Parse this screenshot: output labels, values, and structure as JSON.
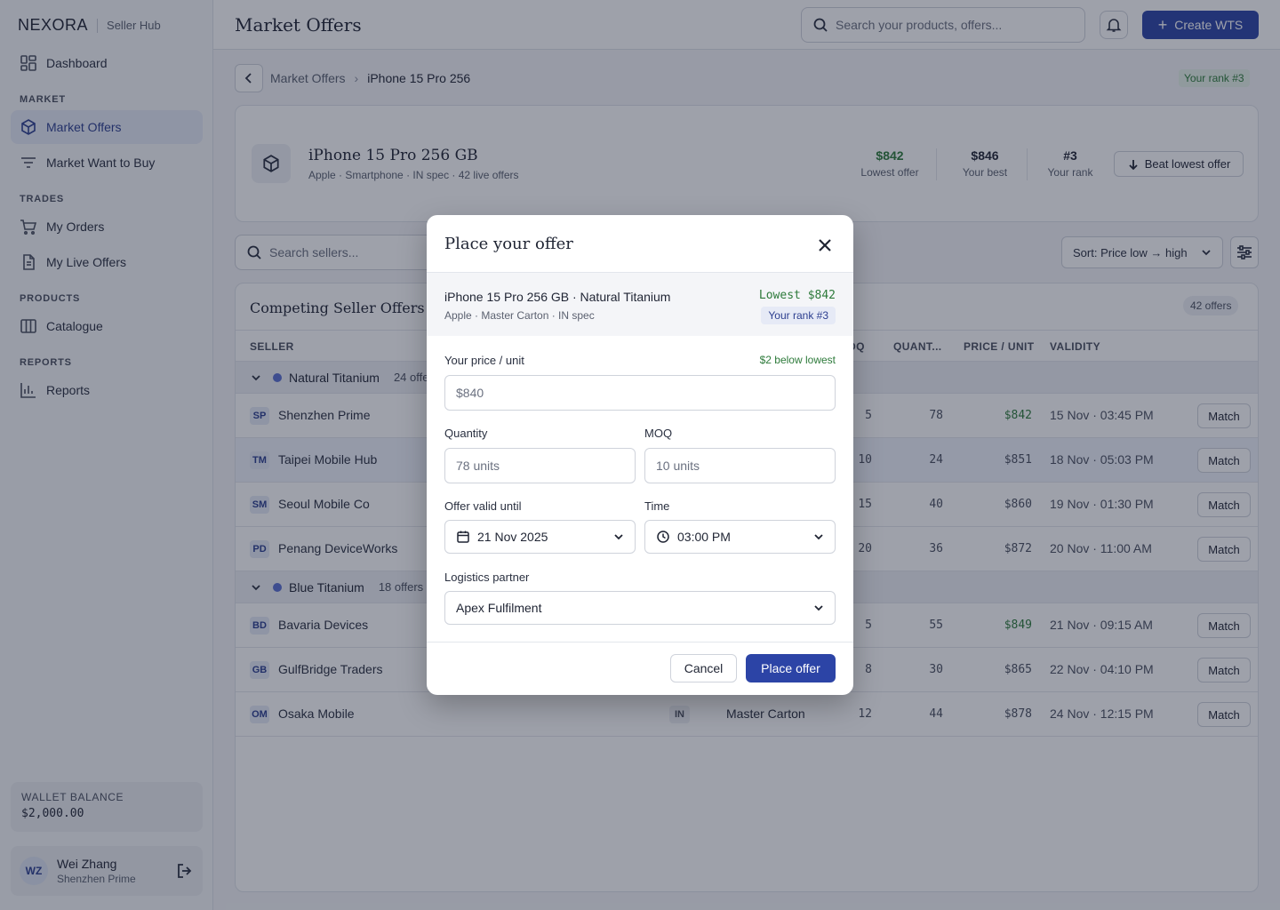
{
  "brand": {
    "name": "NEXORA",
    "sub": "Seller Hub"
  },
  "nav": {
    "dashboard": "Dashboard",
    "section_market": "MARKET",
    "market_offers": "Market Offers",
    "market_wtb": "Market Want to Buy",
    "section_trades": "TRADES",
    "my_orders": "My Orders",
    "my_live_offers": "My Live Offers",
    "section_products": "PRODUCTS",
    "catalogue": "Catalogue",
    "section_reports": "REPORTS",
    "reports": "Reports"
  },
  "wallet": {
    "label": "WALLET BALANCE",
    "value": "$2,000.00"
  },
  "user": {
    "initials": "WZ",
    "name": "Wei Zhang",
    "company": "Shenzhen Prime"
  },
  "topbar": {
    "title": "Market Offers",
    "search_placeholder": "Search your products, offers...",
    "create_label": "Create WTS"
  },
  "breadcrumb": {
    "parent": "Market Offers",
    "current": "iPhone 15 Pro 256",
    "rank_badge": "Your rank #3"
  },
  "product": {
    "title": "iPhone 15 Pro 256 GB",
    "sub": "Apple · Smartphone · IN spec · 42 live offers",
    "lowest_value": "$842",
    "lowest_label": "Lowest offer",
    "best_value": "$846",
    "best_label": "Your best",
    "rank_value": "#3",
    "rank_label": "Your rank",
    "beat_label": "Beat lowest offer"
  },
  "filters": {
    "seller_search_placeholder": "Search sellers...",
    "sort_label": "Sort: Price low → high"
  },
  "table": {
    "title": "Competing Seller Offers",
    "count": "42 offers",
    "headers": {
      "seller": "SELLER",
      "moq": "MOQ",
      "quantity": "QUANT...",
      "price": "PRICE / UNIT",
      "validity": "VALIDITY"
    },
    "groups": [
      {
        "name": "Natural Titanium",
        "count": "24 offers"
      },
      {
        "name": "Blue Titanium",
        "count": "18 offers"
      }
    ],
    "rows": [
      {
        "initials": "SP",
        "name": "Shenzhen Prime",
        "moq": "5",
        "qty": "78",
        "price": "$842",
        "validity": "15 Nov · 03:45 PM",
        "action": "Match"
      },
      {
        "initials": "TM",
        "name": "Taipei Mobile Hub",
        "moq": "10",
        "qty": "24",
        "price": "$851",
        "validity": "18 Nov · 05:03 PM",
        "action": "Match"
      },
      {
        "initials": "SM",
        "name": "Seoul Mobile Co",
        "moq": "15",
        "qty": "40",
        "price": "$860",
        "validity": "19 Nov · 01:30 PM",
        "action": "Match"
      },
      {
        "initials": "PD",
        "name": "Penang DeviceWorks",
        "moq": "20",
        "qty": "36",
        "price": "$872",
        "validity": "20 Nov · 11:00 AM",
        "action": "Match"
      },
      {
        "initials": "BD",
        "name": "Bavaria Devices",
        "moq": "5",
        "qty": "55",
        "price": "$849",
        "validity": "21 Nov · 09:15 AM",
        "action": "Match"
      },
      {
        "initials": "GB",
        "name": "GulfBridge Traders",
        "moq": "8",
        "qty": "30",
        "price": "$865",
        "validity": "22 Nov · 04:10 PM",
        "action": "Match"
      },
      {
        "initials": "OM",
        "name": "Osaka Mobile",
        "spec": "IN",
        "packaging": "Master Carton",
        "moq": "12",
        "qty": "44",
        "price": "$878",
        "validity": "24 Nov · 12:15 PM",
        "action": "Match"
      }
    ]
  },
  "modal": {
    "title": "Place your offer",
    "product_name": "iPhone 15 Pro 256 GB · Natural Titanium",
    "product_sub": "Apple · Master Carton · IN spec",
    "lowest": "Lowest $842",
    "rank": "Your rank #3",
    "price_label": "Your price / unit",
    "price_hint": "$2 below lowest",
    "price_value": "$840",
    "quantity_label": "Quantity",
    "quantity_value": "78 units",
    "moq_label": "MOQ",
    "moq_value": "10 units",
    "valid_label": "Offer valid until",
    "valid_date": "21 Nov 2025",
    "time_label": "Time",
    "time_value": "03:00 PM",
    "logistics_label": "Logistics partner",
    "logistics_value": "Apex Fulfilment",
    "cancel_label": "Cancel",
    "submit_label": "Place offer"
  },
  "colors": {
    "accent": "#2c44a6",
    "positive": "#2d7a3a",
    "overlay": "rgba(24,32,52,0.42)"
  }
}
